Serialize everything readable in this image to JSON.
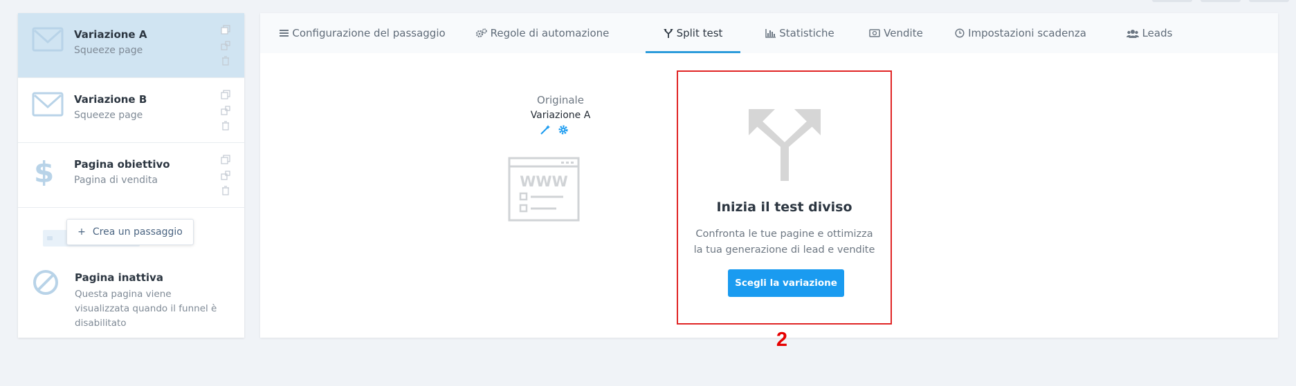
{
  "colors": {
    "accent": "#1a9bf0",
    "active_step_bg": "#d0e4f2",
    "tab_underline": "#2d9cdb",
    "annotation_red": "#e02424",
    "icon_light_blue": "#b8d3e8",
    "illustration_gray": "#d0d3d6"
  },
  "sidebar": {
    "steps": [
      {
        "title": "Variazione A",
        "subtitle": "Squeeze page",
        "icon": "envelope-icon",
        "active": true
      },
      {
        "title": "Variazione B",
        "subtitle": "Squeeze page",
        "icon": "envelope-icon",
        "active": false
      },
      {
        "title": "Pagina obiettivo",
        "subtitle": "Pagina di vendita",
        "icon": "dollar-icon",
        "active": false
      }
    ],
    "step_action_icons": [
      "copy-icon",
      "duplicate-icon",
      "trash-icon"
    ],
    "create_button": {
      "plus": "+",
      "label": "Crea un passaggio"
    },
    "inactive_page": {
      "title": "Pagina inattiva",
      "description": "Questa pagina viene visualizzata quando il funnel è disabilitato",
      "icon": "ban-icon"
    }
  },
  "tabs": [
    {
      "label": "Configurazione del passaggio",
      "icon": "list-icon",
      "active": false
    },
    {
      "label": "Regole di automazione",
      "icon": "gears-icon",
      "active": false
    },
    {
      "label": "Split test",
      "icon": "split-icon",
      "active": true
    },
    {
      "label": "Statistiche",
      "icon": "bar-chart-icon",
      "active": false
    },
    {
      "label": "Vendite",
      "icon": "money-icon",
      "active": false
    },
    {
      "label": "Impostazioni scadenza",
      "icon": "clock-icon",
      "active": false
    },
    {
      "label": "Leads",
      "icon": "users-icon",
      "active": false
    }
  ],
  "original": {
    "label": "Originale",
    "variation": "Variazione A",
    "tool_icons": [
      "magic-wand-icon",
      "gear-icon"
    ],
    "illustration_text": "WWW"
  },
  "split_test": {
    "title": "Inizia il test diviso",
    "description": "Confronta le tue pagine e ottimizza la tua generazione di lead e vendite",
    "button": "Scegli la variazione"
  },
  "annotation": {
    "number": "2"
  }
}
